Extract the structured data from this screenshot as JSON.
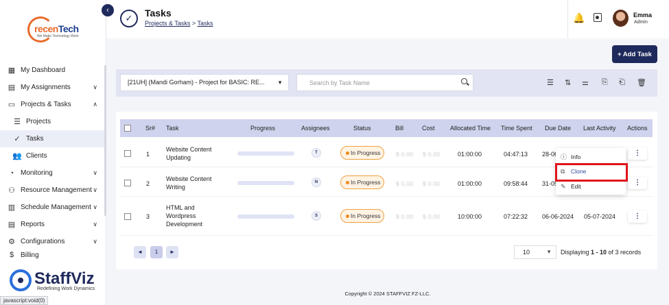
{
  "brand": {
    "logo_text_a": "recen",
    "logo_text_b": "Tech",
    "logo_tagline": "We Make Technology Work",
    "product_name": "StaffViz",
    "product_tagline": "Redefining Work Dynamics"
  },
  "sidebar": {
    "items": [
      {
        "label": "My Dashboard",
        "icon": "dashboard-icon",
        "chevron": ""
      },
      {
        "label": "My Assignments",
        "icon": "assignments-icon",
        "chevron": "⌄"
      },
      {
        "label": "Projects & Tasks",
        "icon": "folder-icon",
        "chevron": "⌃"
      },
      {
        "label": "Projects",
        "icon": "projects-icon",
        "chevron": ""
      },
      {
        "label": "Tasks",
        "icon": "check-circle-icon",
        "chevron": ""
      },
      {
        "label": "Clients",
        "icon": "clients-icon",
        "chevron": ""
      },
      {
        "label": "Monitoring",
        "icon": "monitoring-icon",
        "chevron": "⌄"
      },
      {
        "label": "Resource Management",
        "icon": "resource-icon",
        "chevron": "⌄"
      },
      {
        "label": "Schedule Management",
        "icon": "schedule-icon",
        "chevron": "⌄"
      },
      {
        "label": "Reports",
        "icon": "reports-icon",
        "chevron": "⌄"
      },
      {
        "label": "Configurations",
        "icon": "gear-icon",
        "chevron": "⌄"
      },
      {
        "label": "Billing",
        "icon": "billing-icon",
        "chevron": ""
      }
    ]
  },
  "header": {
    "title": "Tasks",
    "breadcrumb": [
      "Projects & Tasks",
      "Tasks"
    ],
    "breadcrumb_sep": ">",
    "user_name": "Emma",
    "user_role": "Admin"
  },
  "toolbar": {
    "add_task_label": "+ Add Task",
    "project_selected": "[21UH] (Mandi Gorham) - Project for BASIC: RE...",
    "search_placeholder": "Search by Task Name"
  },
  "table": {
    "columns": [
      "Sr#",
      "Task",
      "Progress",
      "Assignees",
      "Status",
      "Bill",
      "Cost",
      "Allocated Time",
      "Time Spent",
      "Due Date",
      "Last Activity",
      "Actions"
    ],
    "rows": [
      {
        "sr": "1",
        "task_line1": "Website Content",
        "task_line2": "Updating",
        "task_line3": "",
        "progress": 0,
        "assignee": "T",
        "status": "In Progress",
        "bill": "$ 0.00",
        "cost": "$ 0.00",
        "allocated": "01:00:00",
        "spent": "04:47:13",
        "due": "28-06",
        "last": ""
      },
      {
        "sr": "2",
        "task_line1": "Website Content",
        "task_line2": "Writing",
        "task_line3": "",
        "progress": 0,
        "assignee": "N",
        "status": "In Progress",
        "bill": "$ 0.00",
        "cost": "$ 0.00",
        "allocated": "01:00:00",
        "spent": "09:58:44",
        "due": "31-05",
        "last": ""
      },
      {
        "sr": "3",
        "task_line1": "HTML and",
        "task_line2": "Wordpress",
        "task_line3": "Development",
        "progress": 0,
        "assignee": "S",
        "status": "In Progress",
        "bill": "$ 0.00",
        "cost": "$ 0.00",
        "allocated": "10:00:00",
        "spent": "07:22:32",
        "due": "06-06-2024",
        "last": "05-07-2024"
      }
    ]
  },
  "dropdown": {
    "items": [
      "Info",
      "Clone",
      "Edit"
    ]
  },
  "pagination": {
    "prev": "◄",
    "current": "1",
    "next": "►",
    "page_size": "10",
    "records_prefix": "Displaying ",
    "records_range": "1 - 10",
    "records_suffix": " of 3 records"
  },
  "footer": {
    "copyright": "Copyright © 2024 STAFFVIZ FZ-LLC."
  },
  "status_bar": {
    "url": "javascript:void(0)"
  }
}
